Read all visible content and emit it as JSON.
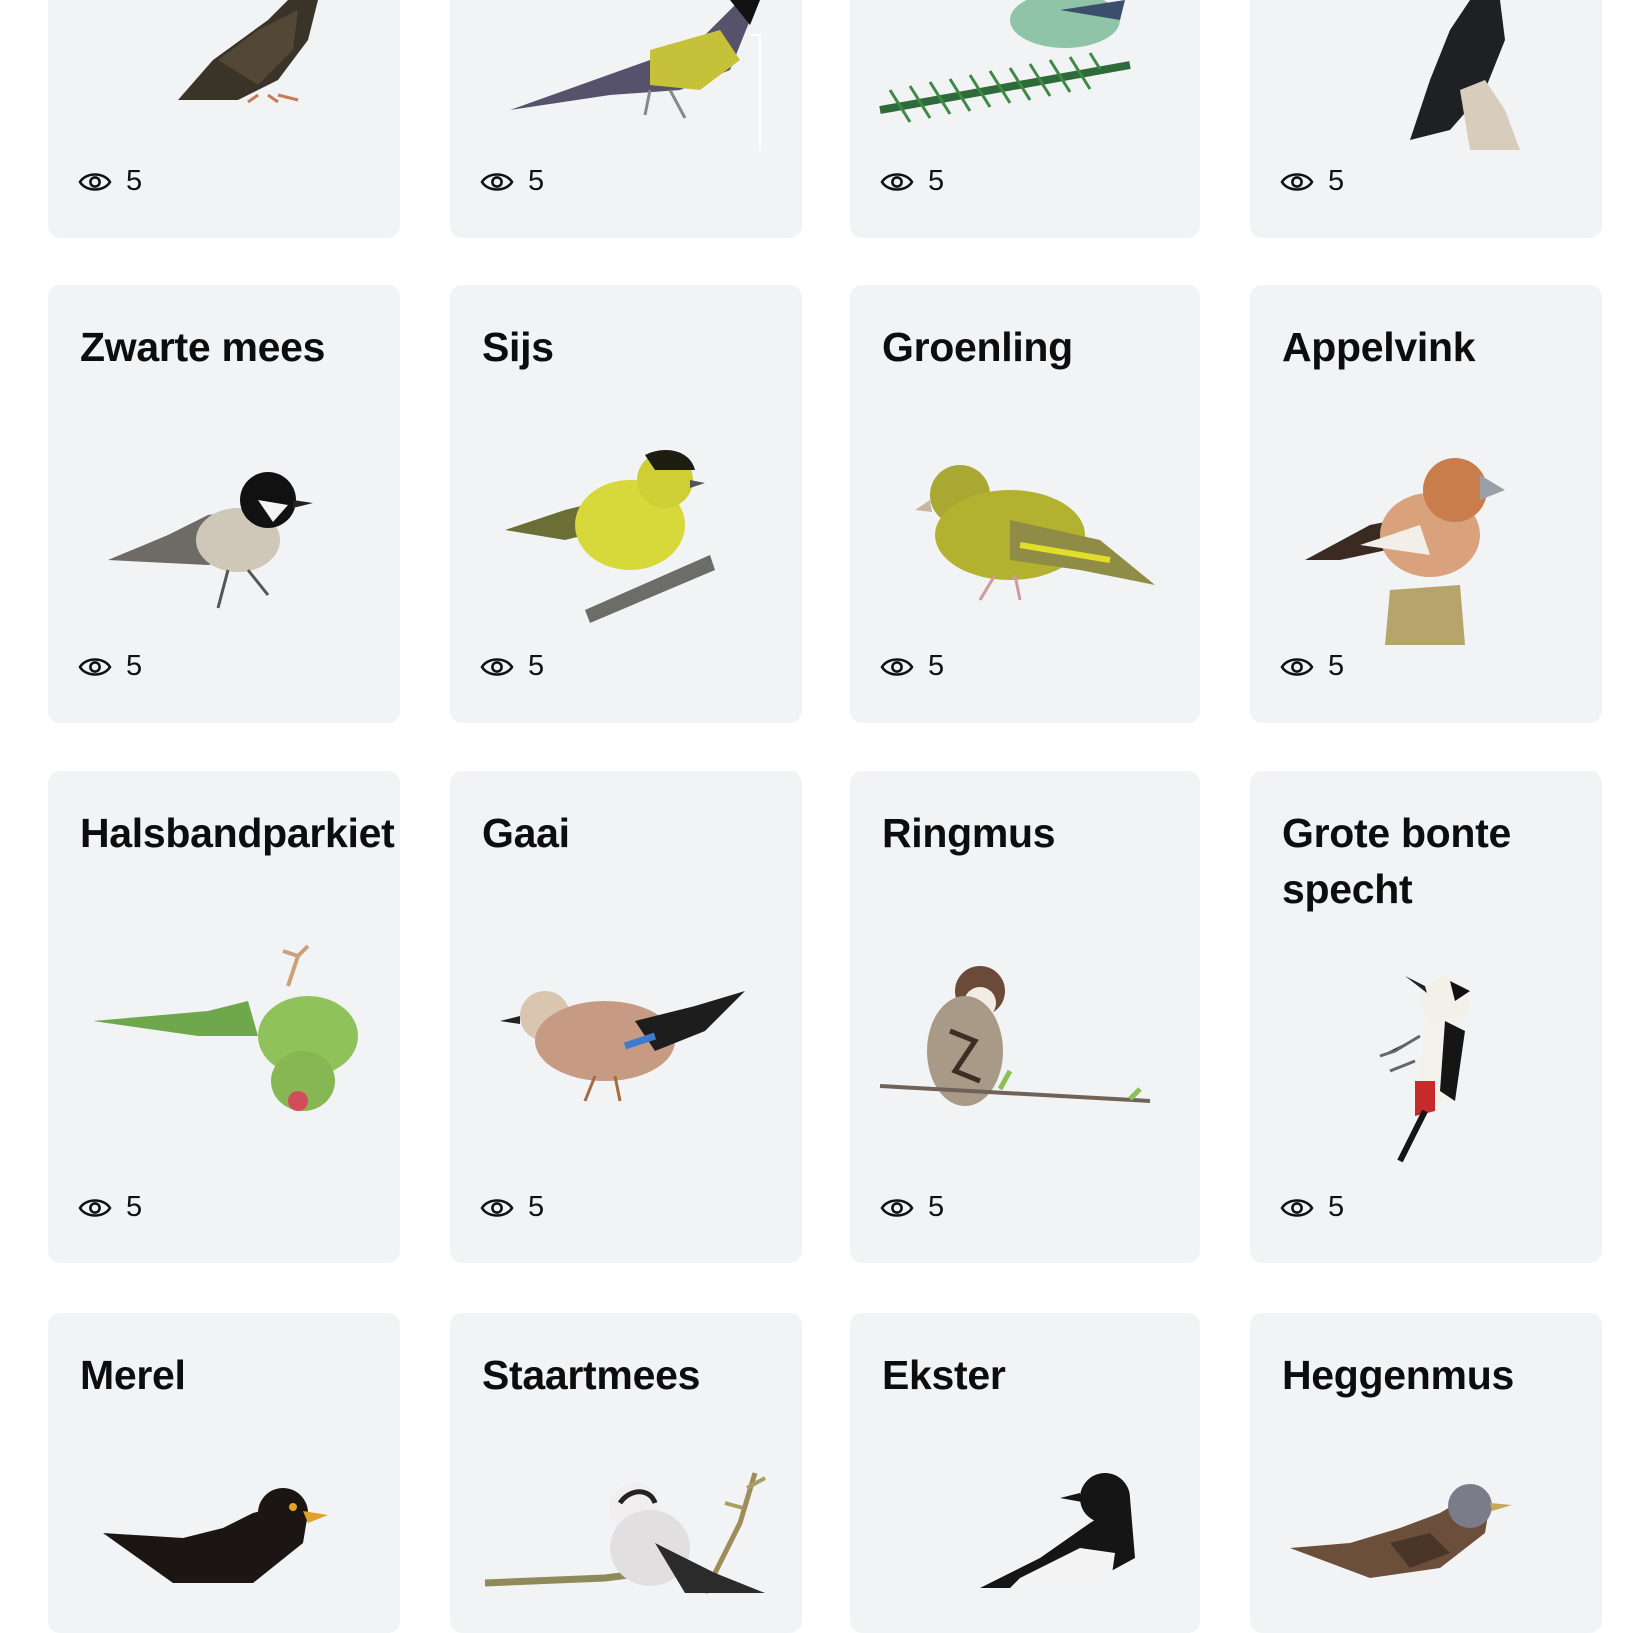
{
  "view_icon": "eye-icon",
  "rows": [
    {
      "cards": [
        {
          "name": "",
          "views": "5",
          "bird": "starling-image"
        },
        {
          "name": "",
          "views": "5",
          "bird": "great-tit-image"
        },
        {
          "name": "",
          "views": "5",
          "bird": "goldcrest-image"
        },
        {
          "name": "",
          "views": "5",
          "bird": "jackdaw-image"
        }
      ]
    },
    {
      "cards": [
        {
          "name": "Zwarte mees",
          "views": "5",
          "bird": "coal-tit-image"
        },
        {
          "name": "Sijs",
          "views": "5",
          "bird": "siskin-image"
        },
        {
          "name": "Groenling",
          "views": "5",
          "bird": "greenfinch-image"
        },
        {
          "name": "Appelvink",
          "views": "5",
          "bird": "hawfinch-image"
        }
      ]
    },
    {
      "cards": [
        {
          "name": "Halsbandparkiet",
          "views": "5",
          "bird": "parakeet-image"
        },
        {
          "name": "Gaai",
          "views": "5",
          "bird": "jay-image"
        },
        {
          "name": "Ringmus",
          "views": "5",
          "bird": "tree-sparrow-image"
        },
        {
          "name": "Grote bonte specht",
          "views": "5",
          "bird": "woodpecker-image"
        }
      ]
    },
    {
      "cards": [
        {
          "name": "Merel",
          "views": "",
          "bird": "blackbird-image"
        },
        {
          "name": "Staartmees",
          "views": "",
          "bird": "long-tailed-tit-image"
        },
        {
          "name": "Ekster",
          "views": "",
          "bird": "magpie-image"
        },
        {
          "name": "Heggenmus",
          "views": "",
          "bird": "dunnock-image"
        }
      ]
    }
  ]
}
